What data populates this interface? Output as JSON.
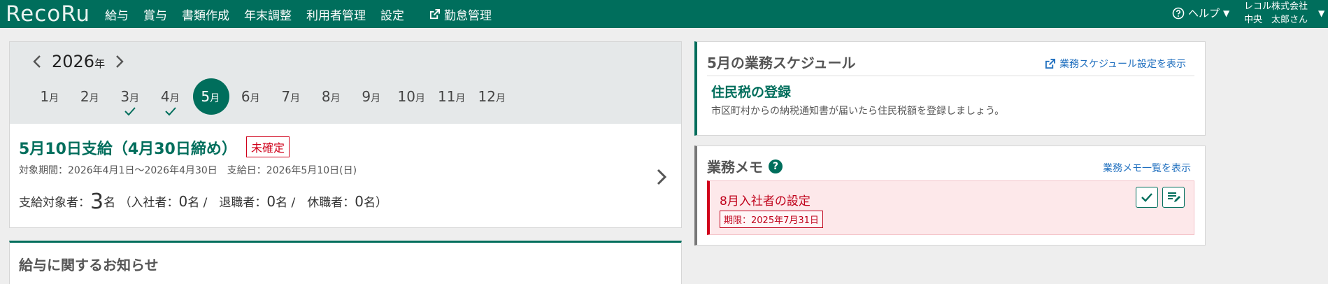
{
  "header": {
    "logo": "RecoRu",
    "nav": [
      "給与",
      "賞与",
      "書類作成",
      "年末調整",
      "利用者管理",
      "設定"
    ],
    "external_nav": "勤怠管理",
    "help": "ヘルプ",
    "company": "レコル株式会社",
    "user": "中央　太郎さん",
    "colors": {
      "primary": "#006e5c"
    }
  },
  "calendar": {
    "year": "2026",
    "year_unit": "年",
    "months": [
      {
        "num": "1",
        "unit": "月",
        "checked": false,
        "active": false
      },
      {
        "num": "2",
        "unit": "月",
        "checked": false,
        "active": false
      },
      {
        "num": "3",
        "unit": "月",
        "checked": true,
        "active": false
      },
      {
        "num": "4",
        "unit": "月",
        "checked": true,
        "active": false
      },
      {
        "num": "5",
        "unit": "月",
        "checked": false,
        "active": true
      },
      {
        "num": "6",
        "unit": "月",
        "checked": false,
        "active": false
      },
      {
        "num": "7",
        "unit": "月",
        "checked": false,
        "active": false
      },
      {
        "num": "8",
        "unit": "月",
        "checked": false,
        "active": false
      },
      {
        "num": "9",
        "unit": "月",
        "checked": false,
        "active": false
      },
      {
        "num": "10",
        "unit": "月",
        "checked": false,
        "active": false
      },
      {
        "num": "11",
        "unit": "月",
        "checked": false,
        "active": false
      },
      {
        "num": "12",
        "unit": "月",
        "checked": false,
        "active": false
      }
    ]
  },
  "payroll": {
    "title": "5月10日支給（4月30日締め）",
    "status": "未確定",
    "period_label": "対象期間：",
    "period": "2026年4月1日〜2026年4月30日",
    "payday_label": "支給日：",
    "payday": "2026年5月10日(日)",
    "targets_label": "支給対象者：",
    "targets_count": "3",
    "unit": "名",
    "joined_label": "（入社者：",
    "joined_count": "0",
    "retired_label": "/　退職者：",
    "retired_count": "0",
    "leave_label": "/　休職者：",
    "leave_count": "0",
    "close_paren": "名）"
  },
  "notice": {
    "title": "給与に関するお知らせ"
  },
  "schedule": {
    "title": "5月の業務スケジュール",
    "link": "業務スケジュール設定を表示",
    "item_title": "住民税の登録",
    "item_desc": "市区町村からの納税通知書が届いたら住民税額を登録しましょう。"
  },
  "memo": {
    "title": "業務メモ",
    "link": "業務メモ一覧を表示",
    "item_title": "8月入社者の設定",
    "item_deadline": "期限：2025年7月31日"
  }
}
